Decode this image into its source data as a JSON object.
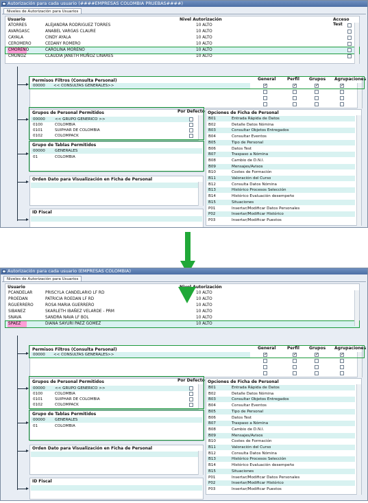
{
  "top": {
    "title": "Autorización para cada usuario (####EMPRESAS COLOMBIA PRUEBAS####)",
    "tab": "Niveles de Autorización para Usuarios",
    "cols": {
      "usuario": "Usuario",
      "nivel": "Nivel Autorización",
      "acceso": "Acceso Test"
    },
    "users": [
      {
        "code": "ATORRES",
        "name": "ALEJANDRA RODRIGUEZ TORRES",
        "level": "10 ALTO"
      },
      {
        "code": "AVARGASC",
        "name": "ANABEL VARGAS CLAURE",
        "level": "10 ALTO"
      },
      {
        "code": "CAYALA",
        "name": "CINDY AYALA",
        "level": "10 ALTO"
      },
      {
        "code": "CEROMERO",
        "name": "CEDANY ROMERO",
        "level": "10 ALTO"
      },
      {
        "code": "CMORENO",
        "name": "CAROLINA MORENO",
        "level": "10 ALTO"
      },
      {
        "code": "CMUNOZ",
        "name": "CLAUDIA JANETH MUÑOZ LINARES",
        "level": "10 ALTO"
      }
    ]
  },
  "bottom": {
    "title": "Autorización para cada usuario (EMPRESAS COLOMBIA)",
    "tab": "Niveles de Autorización para Usuarios",
    "cols": {
      "usuario": "Usuario",
      "nivel": "Nivel Autorización"
    },
    "users": [
      {
        "code": "PCANDELAR",
        "name": "PRISCYLA CANDELARIO LF RD",
        "level": "10 ALTO"
      },
      {
        "code": "PROEDAN",
        "name": "PATRICIA ROEDAN LF RD",
        "level": "10 ALTO"
      },
      {
        "code": "RGUERRERO",
        "name": "ROSA MARIA GUERRERO",
        "level": "10 ALTO"
      },
      {
        "code": "SIBANEZ",
        "name": "SKARLETH IBAÑEZ VELARDE - PRM",
        "level": "10 ALTO"
      },
      {
        "code": "SNAVA",
        "name": "SANDRA NAVA LF BOL",
        "level": "10 ALTO"
      },
      {
        "code": "SPAEZ",
        "name": "DIANA SAYURI PAEZ GOMEZ",
        "level": "10 ALTO"
      }
    ]
  },
  "permisos": {
    "title": "Permisos Filtros (Consulta Personal)",
    "row_code": "00000",
    "row_name": "<< CONSULTAS GENERALES>>",
    "cols": [
      "General",
      "Perfil",
      "Grupos",
      "Agrupaciones"
    ]
  },
  "grupos": {
    "title": "Grupos de Personal Permitidos",
    "default_label": "Por Defecto",
    "rows": [
      {
        "code": "00000",
        "name": "<< GRUPO GENERICO >>"
      },
      {
        "code": "0100",
        "name": "COLOMBIA"
      },
      {
        "code": "0101",
        "name": "SUIPHAR DE COLOMBIA"
      },
      {
        "code": "0102",
        "name": "COLOMPACK"
      }
    ]
  },
  "tablas": {
    "title": "Grupo de Tablas Permitidos",
    "rows": [
      {
        "code": "00000",
        "name": "GENERALES"
      },
      {
        "code": "01",
        "name": "COLOMBIA"
      }
    ]
  },
  "orden": {
    "title": "Orden  Dato para Visualización en Ficha de Personal"
  },
  "idfiscal": {
    "title": "ID Fiscal"
  },
  "opciones": {
    "title": "Opciones de Ficha de Personal",
    "rows": [
      {
        "code": "B01",
        "name": "Entrada Rápida de Datos"
      },
      {
        "code": "B02",
        "name": "Detalle Datos Nómina"
      },
      {
        "code": "B03",
        "name": "Consultar Objetos Entregados"
      },
      {
        "code": "B04",
        "name": "Consultar Eventos"
      },
      {
        "code": "B05",
        "name": "Tipo de Personal"
      },
      {
        "code": "B06",
        "name": "Datos Test"
      },
      {
        "code": "B07",
        "name": "Traspaso a Nómina"
      },
      {
        "code": "B08",
        "name": "Cambio de D.N.I."
      },
      {
        "code": "B09",
        "name": "Mensajes/Avisos"
      },
      {
        "code": "B10",
        "name": "Costes de Formación"
      },
      {
        "code": "B11",
        "name": "Valoración del Curso"
      },
      {
        "code": "B12",
        "name": "Consulta Datos Nómina"
      },
      {
        "code": "B13",
        "name": "Histórico Procesos Selección"
      },
      {
        "code": "B14",
        "name": "Histórico Evaluación desempeño"
      },
      {
        "code": "B15",
        "name": "Situaciones"
      },
      {
        "code": "P01",
        "name": "Insertar/Modificar Datos Personales"
      },
      {
        "code": "P02",
        "name": "Insertar/Modificar Histórico"
      },
      {
        "code": "P03",
        "name": "Insertar/Modificar Puestos"
      }
    ]
  },
  "colors": {
    "highlight": "#d8f2f1",
    "selected": "#ff9ed6",
    "frame": "#1c9a3c",
    "arrow": "#20a838"
  }
}
